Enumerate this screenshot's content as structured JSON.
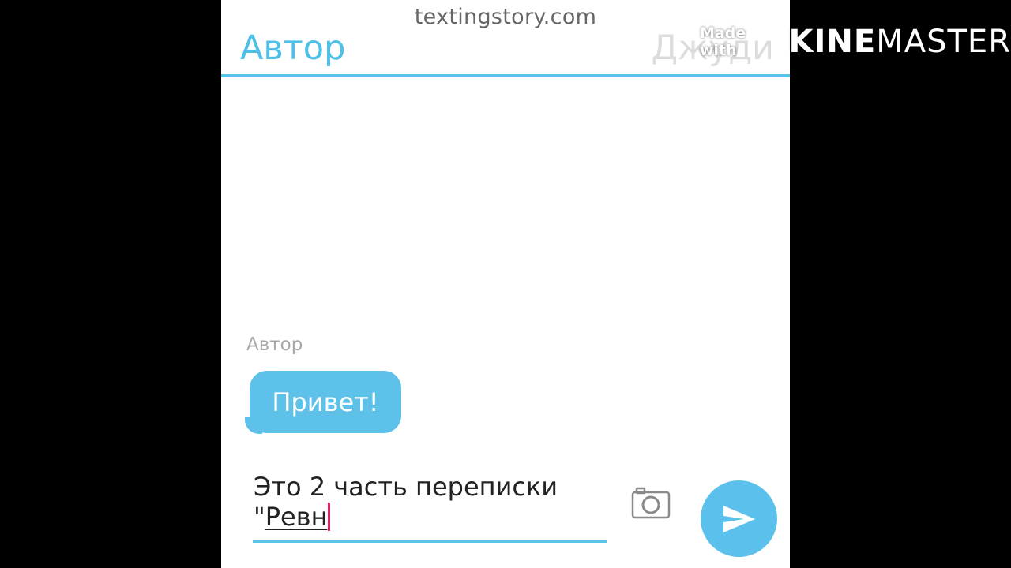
{
  "site": "textingstory.com",
  "tabs": {
    "left": "Автор",
    "right": "Джуди"
  },
  "messages": [
    {
      "sender": "Автор",
      "text": "Привет!"
    }
  ],
  "input": {
    "line1": "Это 2 часть переписки",
    "line2_prefix": "\"",
    "line2_word": "Ревн"
  },
  "watermark": {
    "made_with": "Made with",
    "brand_bold": "KINE",
    "brand_regular": "MASTER"
  },
  "icons": {
    "camera": "camera-icon",
    "send": "send-icon"
  },
  "colors": {
    "accent": "#5bc1ec",
    "bubble": "#5ec1ea",
    "caret": "#e91e63"
  }
}
